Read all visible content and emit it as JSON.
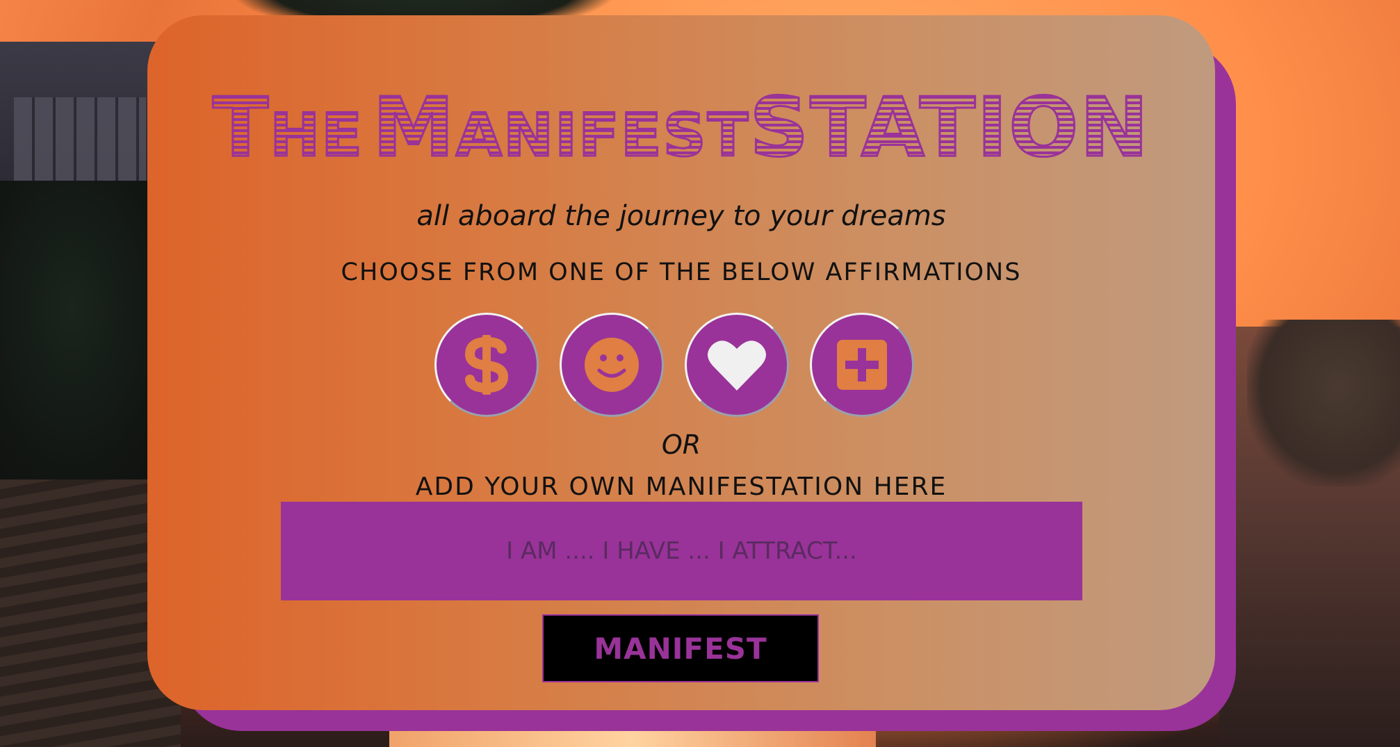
{
  "app": {
    "title_words": [
      "T",
      "HE",
      "M",
      "ANIFEST",
      "STATION"
    ],
    "tagline": "all aboard the journey to your dreams",
    "choose_prompt": "CHOOSE FROM ONE OF THE BELOW AFFIRMATIONS",
    "or_label": "OR",
    "add_own_prompt": "ADD YOUR OWN MANIFESTATION HERE"
  },
  "affirmations": [
    {
      "icon": "dollar-icon"
    },
    {
      "icon": "smiley-face-icon"
    },
    {
      "icon": "heart-icon"
    },
    {
      "icon": "plus-square-icon"
    }
  ],
  "input": {
    "placeholder": "I AM .... I HAVE ... I ATTRACT...",
    "value": ""
  },
  "submit": {
    "label": "MANIFEST"
  },
  "colors": {
    "accent_purple": "#993399",
    "card_left": "#dd642a",
    "card_right": "#c09a7e",
    "icon_fill": "#e07e44"
  }
}
